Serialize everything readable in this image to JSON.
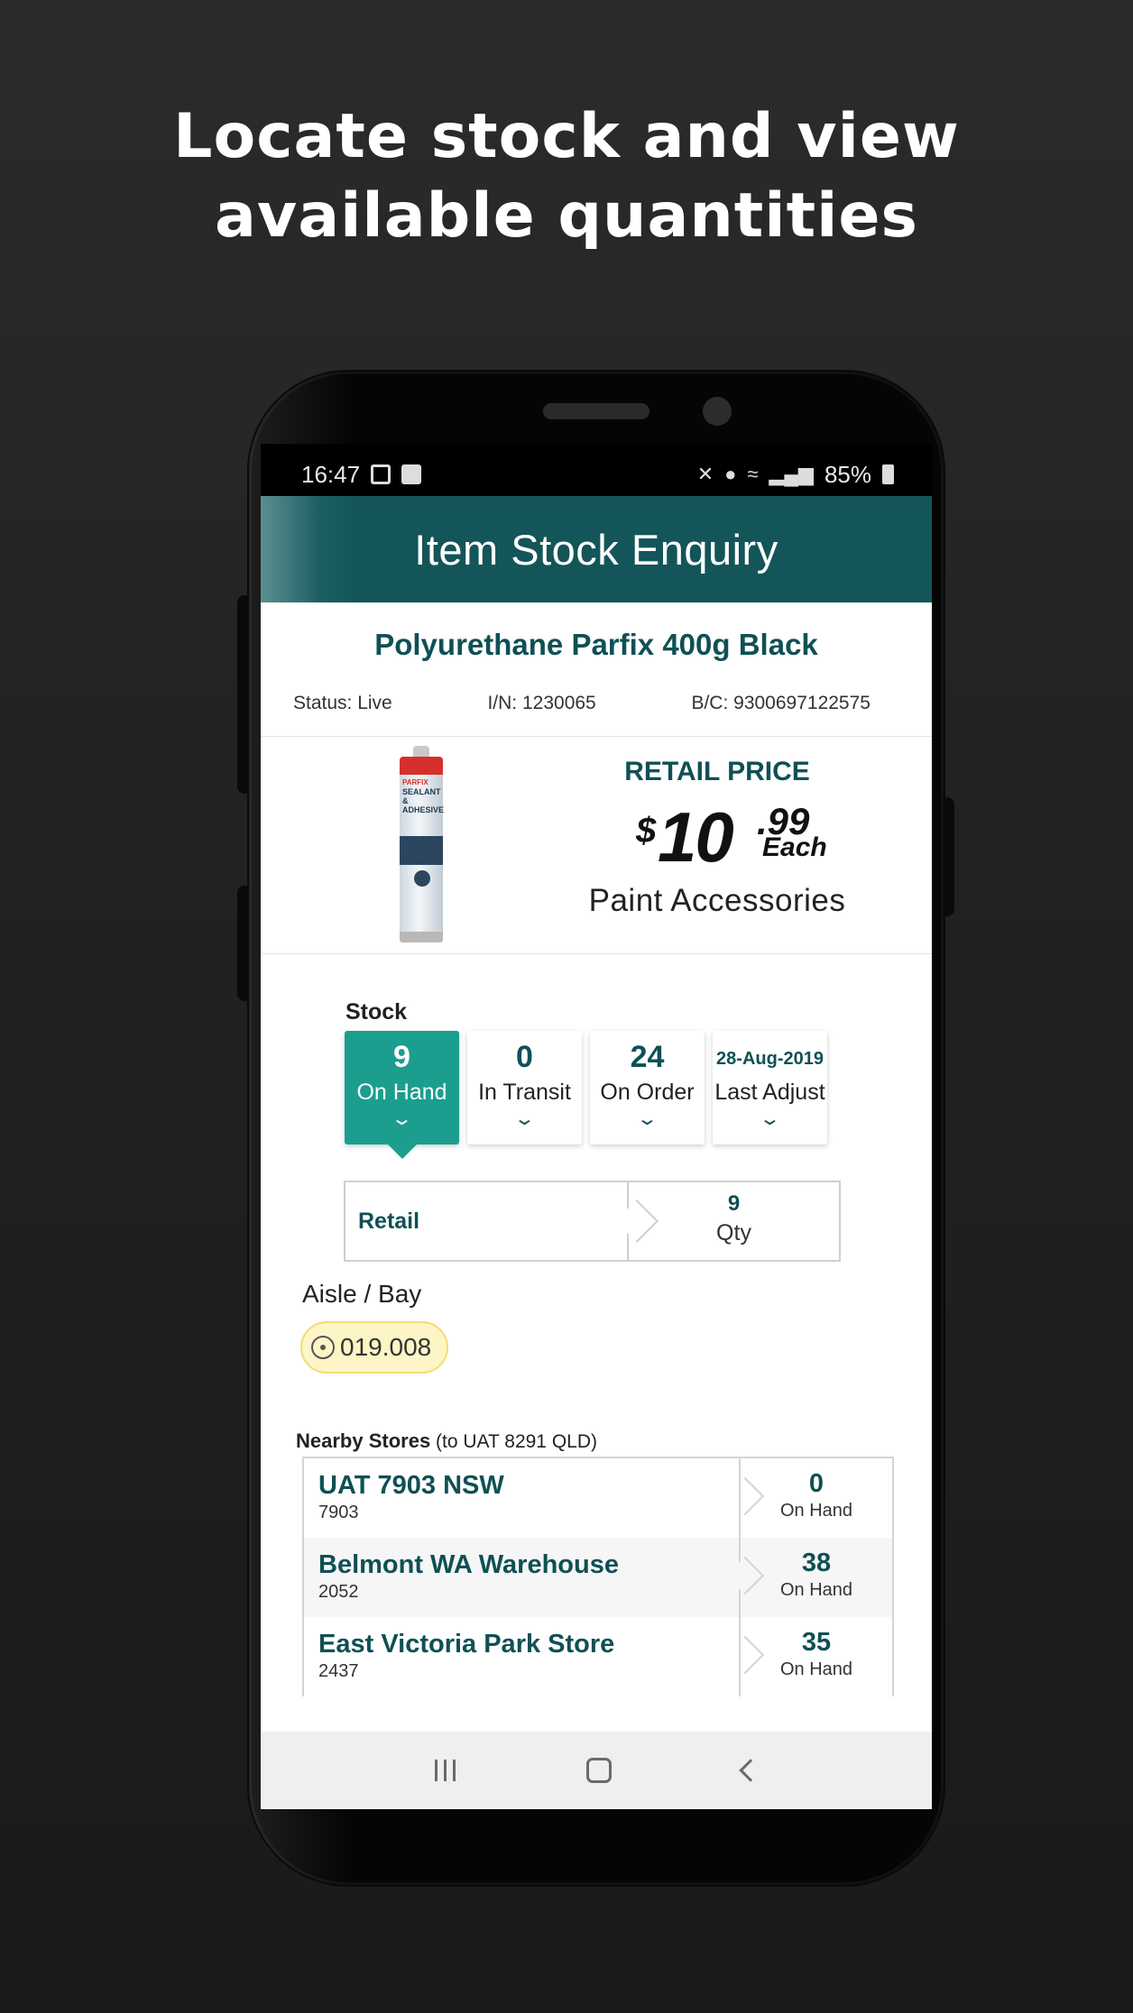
{
  "headline": {
    "line1": "Locate stock and view",
    "line2": "available quantities"
  },
  "statusbar": {
    "time": "16:47",
    "battery": "85%",
    "icons": [
      "image-icon",
      "check-icon",
      "mute-icon",
      "location-icon",
      "wifi-icon",
      "signal-icon",
      "battery-icon"
    ]
  },
  "appbar": {
    "title": "Item Stock Enquiry"
  },
  "product": {
    "name": "Polyurethane Parfix 400g Black",
    "status": "Status: Live",
    "item_number": "I/N: 1230065",
    "barcode": "B/C: 9300697122575",
    "image_label": "SEALANT & ADHESIVE",
    "image_brand": "PARFIX"
  },
  "price": {
    "label": "RETAIL PRICE",
    "currency": "$",
    "whole": "10",
    "cents": ".99",
    "unit": "Each",
    "category": "Paint Accessories"
  },
  "stock": {
    "title": "Stock",
    "tiles": [
      {
        "value": "9",
        "label": "On Hand",
        "active": true
      },
      {
        "value": "0",
        "label": "In Transit",
        "active": false
      },
      {
        "value": "24",
        "label": "On Order",
        "active": false
      },
      {
        "value": "28-Aug-2019",
        "label": "Last Adjust",
        "active": false
      }
    ],
    "retail": {
      "label": "Retail",
      "qty": "9",
      "qty_label": "Qty"
    }
  },
  "location": {
    "label": "Aisle / Bay",
    "value": "019.008"
  },
  "nearby": {
    "title": "Nearby Stores",
    "subtitle": "(to UAT 8291 QLD)",
    "stores": [
      {
        "name": "UAT 7903 NSW",
        "code": "7903",
        "qty": "0",
        "qty_label": "On Hand"
      },
      {
        "name": "Belmont WA Warehouse",
        "code": "2052",
        "qty": "38",
        "qty_label": "On Hand"
      },
      {
        "name": "East Victoria Park Store",
        "code": "2437",
        "qty": "35",
        "qty_label": "On Hand"
      }
    ]
  },
  "colors": {
    "brand": "#135558",
    "accent": "#1b9e8e",
    "text_teal": "#0f5055",
    "location_pill": "#fdf5c5"
  }
}
